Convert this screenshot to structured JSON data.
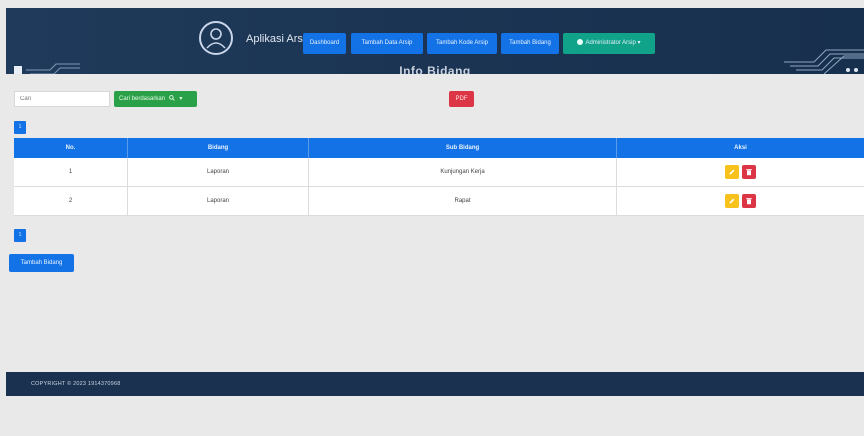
{
  "header": {
    "app_title": "Aplikasi Arsip",
    "nav": [
      {
        "label": "Dashboard"
      },
      {
        "label": "Tambah Data Arsip"
      },
      {
        "label": "Tambah Kode Arsip"
      },
      {
        "label": "Tambah Bidang"
      }
    ],
    "user_menu": {
      "label": "Administrator Arsip",
      "icon": "user-circle-icon",
      "caret": "▾"
    },
    "page_heading": "Info Bidang"
  },
  "controls": {
    "search_placeholder": "Cari",
    "filter_label": "Cari berdasarkan",
    "filter_icon": "search-icon",
    "filter_caret": "▾",
    "pdf_label": "PDF",
    "page_top": "1",
    "page_bottom": "1"
  },
  "table": {
    "headers": [
      "No.",
      "Bidang",
      "Sub Bidang",
      "Aksi"
    ],
    "rows": [
      {
        "no": "1",
        "bidang": "Laporan",
        "sub_bidang": "Kunjungan Kerja"
      },
      {
        "no": "2",
        "bidang": "Laporan",
        "sub_bidang": "Rapat"
      }
    ]
  },
  "add_button": "Tambah Bidang",
  "footer": {
    "copyright": "COPYRIGHT © 2023 1914370968"
  },
  "colors": {
    "header_bg": "#1b3453",
    "primary": "#1373e6",
    "success": "#2aa148",
    "danger": "#dc3545",
    "warning": "#f7c21b",
    "teal": "#11a389"
  }
}
